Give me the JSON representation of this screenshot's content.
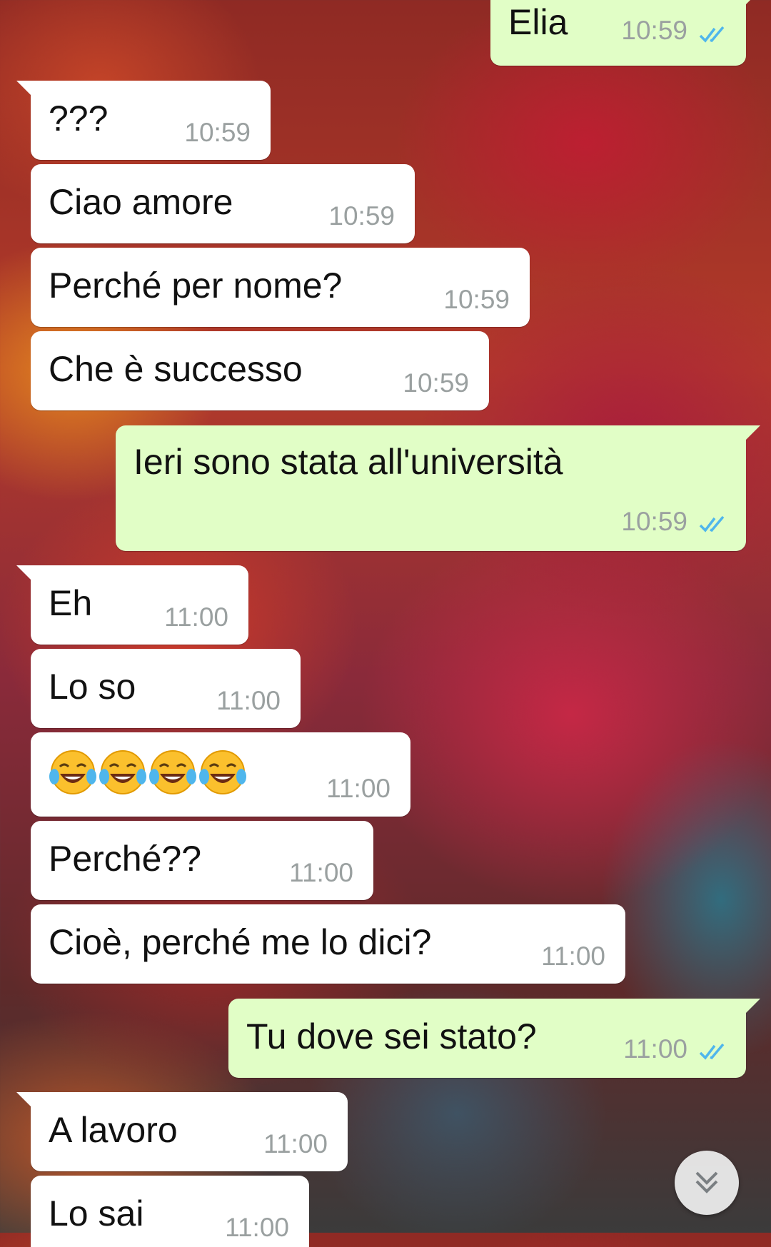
{
  "chat": {
    "messages": [
      {
        "direction": "out",
        "text": "Elia",
        "time": "10:59",
        "status": "read"
      },
      {
        "direction": "in",
        "text": "???",
        "time": "10:59"
      },
      {
        "direction": "in",
        "text": "Ciao amore",
        "time": "10:59"
      },
      {
        "direction": "in",
        "text": "Perché per nome?",
        "time": "10:59"
      },
      {
        "direction": "in",
        "text": "Che è successo",
        "time": "10:59"
      },
      {
        "direction": "out",
        "text": "Ieri sono stata all'università",
        "time": "10:59",
        "status": "read"
      },
      {
        "direction": "in",
        "text": "Eh",
        "time": "11:00"
      },
      {
        "direction": "in",
        "text": "Lo so",
        "time": "11:00"
      },
      {
        "direction": "in",
        "text": "😂😂😂😂",
        "time": "11:00",
        "emoji": "face-with-tears-of-joy",
        "emoji_count": 4
      },
      {
        "direction": "in",
        "text": "Perché??",
        "time": "11:00"
      },
      {
        "direction": "in",
        "text": "Cioè, perché me lo dici?",
        "time": "11:00"
      },
      {
        "direction": "out",
        "text": "Tu dove sei stato?",
        "time": "11:00",
        "status": "read"
      },
      {
        "direction": "in",
        "text": "A lavoro",
        "time": "11:00"
      },
      {
        "direction": "in",
        "text": "Lo sai",
        "time": "11:00"
      }
    ]
  },
  "colors": {
    "incoming_bubble": "#ffffff",
    "outgoing_bubble": "#e1fec6",
    "read_ticks": "#4fb6ec",
    "timestamp": "#9aa0a0"
  },
  "scroll_button": {
    "icon": "double-chevron-down-icon"
  }
}
